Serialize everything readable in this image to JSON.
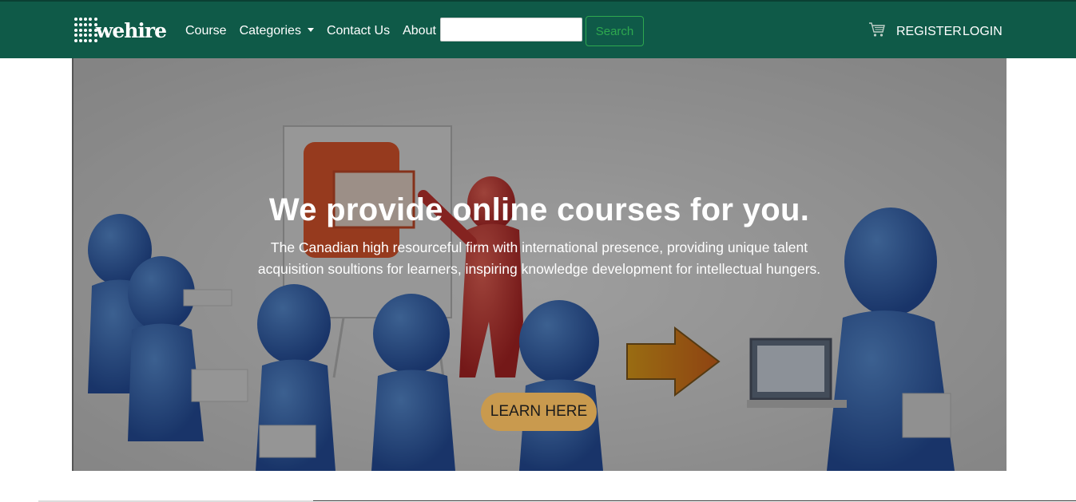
{
  "navbar": {
    "logo_text": "wehire",
    "links": [
      {
        "label": "Course"
      },
      {
        "label": "Categories"
      },
      {
        "label": "Contact Us"
      },
      {
        "label": "About"
      }
    ],
    "search": {
      "value": "",
      "placeholder": ""
    },
    "search_button_label": "Search",
    "cart_icon": "cart-icon",
    "register_label": "REGISTER",
    "login_label": "LOGIN"
  },
  "hero": {
    "title": "We provide online courses for you.",
    "description": "The Canadian high resourceful firm with international presence, providing unique talent acquisition soultions for learners, inspiring knowledge development for intellectual hungers.",
    "button_label": "LEARN HERE"
  },
  "colors": {
    "navbar_bg": "#0f5a48",
    "search_button": "#2ea84f",
    "cta_button": "#c99a4e"
  }
}
